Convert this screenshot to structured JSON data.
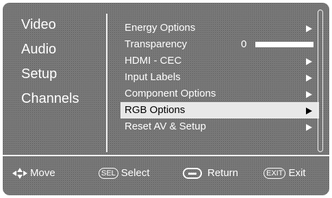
{
  "left_menu": {
    "items": [
      {
        "label": "Video"
      },
      {
        "label": "Audio"
      },
      {
        "label": "Setup"
      },
      {
        "label": "Channels"
      }
    ]
  },
  "submenu": {
    "items": [
      {
        "label": "Energy Options",
        "arrow": true
      },
      {
        "label": "Transparency",
        "value": "0",
        "level": 0
      },
      {
        "label": "HDMI - CEC",
        "arrow": true
      },
      {
        "label": "Input Labels",
        "arrow": true
      },
      {
        "label": "Component Options",
        "arrow": true
      },
      {
        "label": "RGB Options",
        "arrow": true,
        "selected": true
      },
      {
        "label": "Reset AV & Setup",
        "arrow": true
      }
    ]
  },
  "footer": {
    "move_label": "Move",
    "select_key": "SEL",
    "select_label": "Select",
    "return_label": "Return",
    "exit_key": "EXIT",
    "exit_label": "Exit"
  },
  "colors": {
    "background": "#9a9a9a",
    "text": "#ffffff",
    "highlight": "#e8e8e8"
  }
}
